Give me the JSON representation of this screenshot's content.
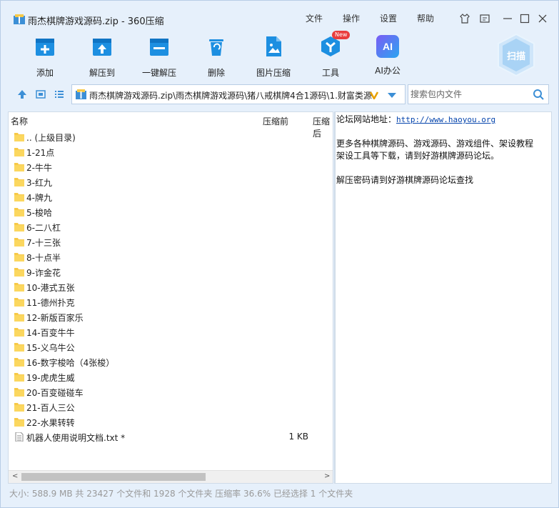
{
  "window": {
    "title": "雨杰棋牌游戏源码.zip - 360压缩",
    "menu": [
      "文件",
      "操作",
      "设置",
      "帮助"
    ]
  },
  "toolbar": {
    "items": [
      {
        "label": "添加",
        "icon": "add-archive-icon"
      },
      {
        "label": "解压到",
        "icon": "extract-to-icon"
      },
      {
        "label": "一键解压",
        "icon": "one-click-extract-icon"
      },
      {
        "label": "删除",
        "icon": "delete-icon"
      },
      {
        "label": "图片压缩",
        "icon": "image-compress-icon"
      },
      {
        "label": "工具",
        "icon": "tools-icon"
      },
      {
        "label": "AI办公",
        "icon": "ai-office-icon"
      }
    ],
    "new_badge": "New",
    "ai_glyph": "AI",
    "scan_label": "扫描"
  },
  "address": {
    "path": "雨杰棋牌游戏源码.zip\\雨杰棋牌游戏源码\\猪八戒棋牌4合1源码\\1.财富类源"
  },
  "search": {
    "placeholder": "搜索包内文件"
  },
  "filelist": {
    "columns": [
      "名称",
      "压缩前",
      "压缩后"
    ],
    "rows": [
      {
        "name": ".. (上级目录)",
        "type": "folder",
        "size": ""
      },
      {
        "name": "1-21点",
        "type": "folder",
        "size": ""
      },
      {
        "name": "2-牛牛",
        "type": "folder",
        "size": ""
      },
      {
        "name": "3-红九",
        "type": "folder",
        "size": ""
      },
      {
        "name": "4-牌九",
        "type": "folder",
        "size": ""
      },
      {
        "name": "5-梭哈",
        "type": "folder",
        "size": ""
      },
      {
        "name": "6-二八杠",
        "type": "folder",
        "size": ""
      },
      {
        "name": "7-十三张",
        "type": "folder",
        "size": ""
      },
      {
        "name": "8-十点半",
        "type": "folder",
        "size": ""
      },
      {
        "name": "9-诈金花",
        "type": "folder",
        "size": ""
      },
      {
        "name": "10-港式五张",
        "type": "folder",
        "size": ""
      },
      {
        "name": "11-德州扑克",
        "type": "folder",
        "size": ""
      },
      {
        "name": "12-新版百家乐",
        "type": "folder",
        "size": ""
      },
      {
        "name": "14-百变牛牛",
        "type": "folder",
        "size": ""
      },
      {
        "name": "15-义乌牛公",
        "type": "folder",
        "size": ""
      },
      {
        "name": "16-数字梭哈（4张梭）",
        "type": "folder",
        "size": ""
      },
      {
        "name": "19-虎虎生威",
        "type": "folder",
        "size": ""
      },
      {
        "name": "20-百变碰碰车",
        "type": "folder",
        "size": ""
      },
      {
        "name": "21-百人三公",
        "type": "folder",
        "size": ""
      },
      {
        "name": "22-水果转转",
        "type": "folder",
        "size": ""
      },
      {
        "name": "机器人使用说明文档.txt *",
        "type": "file",
        "size": "1 KB"
      }
    ]
  },
  "preview": {
    "forum_label": "论坛网站地址：",
    "forum_url": "http://www.haoyou.org",
    "line1": "更多各种棋牌源码、游戏源码、游戏组件、架设教程",
    "line2": "架设工具等下载，请到好游棋牌源码论坛。",
    "line3": "解压密码请到好游棋牌源码论坛查找"
  },
  "status": {
    "text": "大小: 588.9 MB 共 23427 个文件和 1928 个文件夹 压缩率 36.6% 已经选择 1 个文件夹"
  },
  "colors": {
    "window_bg": "#e6f0fb",
    "folder": "#f7c948",
    "toolbar_blue": "#1d8fe1",
    "badge_red": "#e93d3d",
    "link": "#0645ad"
  }
}
